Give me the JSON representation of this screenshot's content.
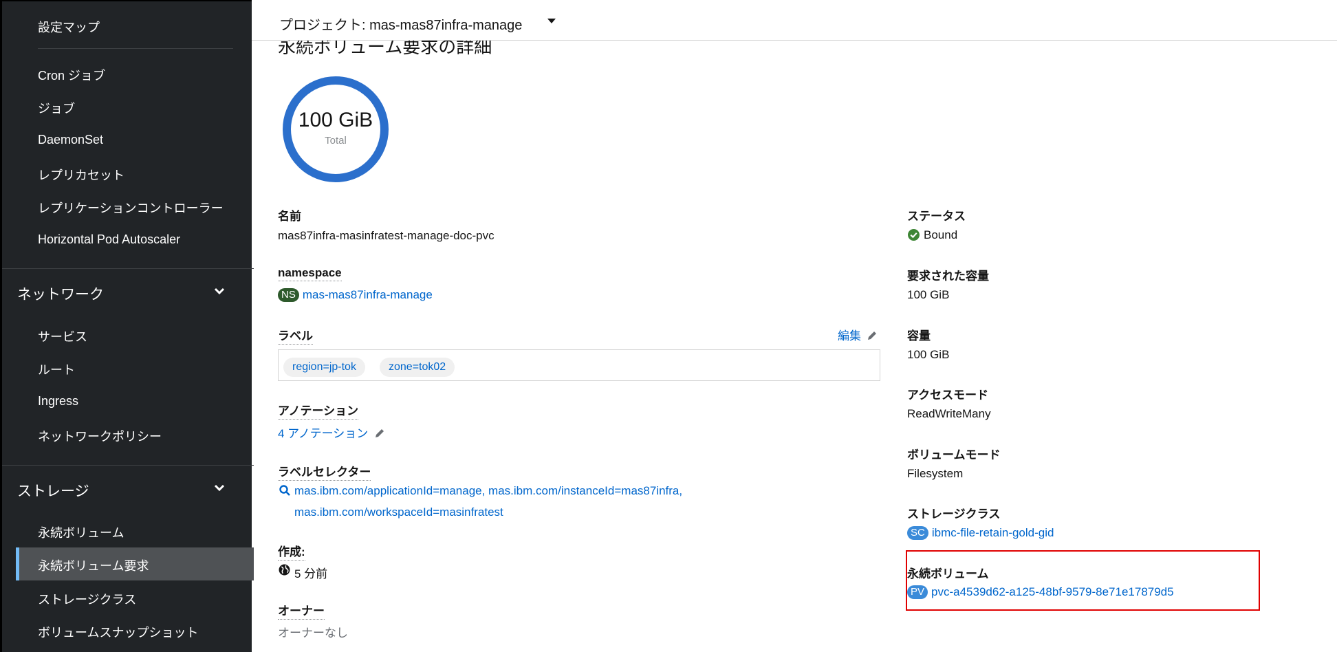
{
  "sidebar": {
    "items_top": [
      "設定マップ",
      "Cron ジョブ",
      "ジョブ",
      "DaemonSet",
      "レプリカセット",
      "レプリケーションコントローラー",
      "Horizontal Pod Autoscaler"
    ],
    "network": {
      "label": "ネットワーク",
      "items": [
        "サービス",
        "ルート",
        "Ingress",
        "ネットワークポリシー"
      ]
    },
    "storage": {
      "label": "ストレージ",
      "items": [
        "永続ボリューム",
        "永続ボリューム要求",
        "ストレージクラス",
        "ボリュームスナップショット"
      ]
    }
  },
  "topbar": {
    "project": "プロジェクト: mas-mas87infra-manage"
  },
  "page": {
    "title": "永続ボリューム要求の詳細"
  },
  "donut": {
    "value": "100 GiB",
    "sub": "Total"
  },
  "left": {
    "name_label": "名前",
    "name_value": "mas87infra-masinfratest-manage-doc-pvc",
    "namespace_label": "namespace",
    "namespace_badge": "NS",
    "namespace_value": "mas-mas87infra-manage",
    "labels_label": "ラベル",
    "edit_label": "編集",
    "chips": [
      "region=jp-tok",
      "zone=tok02"
    ],
    "annotations_label": "アノテーション",
    "annotations_value": "4 アノテーション",
    "selector_label": "ラベルセレクター",
    "selector_line1": "mas.ibm.com/applicationId=manage, mas.ibm.com/instanceId=mas87infra,",
    "selector_line2": "mas.ibm.com/workspaceId=masinfratest",
    "created_label": "作成:",
    "created_value": "5 分前",
    "owner_label": "オーナー",
    "owner_value": "オーナーなし"
  },
  "right": {
    "status_label": "ステータス",
    "status_value": "Bound",
    "requested_label": "要求された容量",
    "requested_value": "100 GiB",
    "capacity_label": "容量",
    "capacity_value": "100 GiB",
    "access_label": "アクセスモード",
    "access_value": "ReadWriteMany",
    "volmode_label": "ボリュームモード",
    "volmode_value": "Filesystem",
    "sc_label": "ストレージクラス",
    "sc_badge": "SC",
    "sc_value": "ibmc-file-retain-gold-gid",
    "pv_label": "永続ボリューム",
    "pv_badge": "PV",
    "pv_value": "pvc-a4539d62-a125-48bf-9579-8e71e17879d5"
  },
  "colors": {
    "accent": "#0066cc",
    "donut": "#2b6fcc",
    "ns_badge": "#2e5a2c",
    "sc_pv_badge": "#3b8bd9",
    "status_ok": "#3e8635",
    "highlight": "#e00000",
    "sidebar_bg": "#212427"
  }
}
